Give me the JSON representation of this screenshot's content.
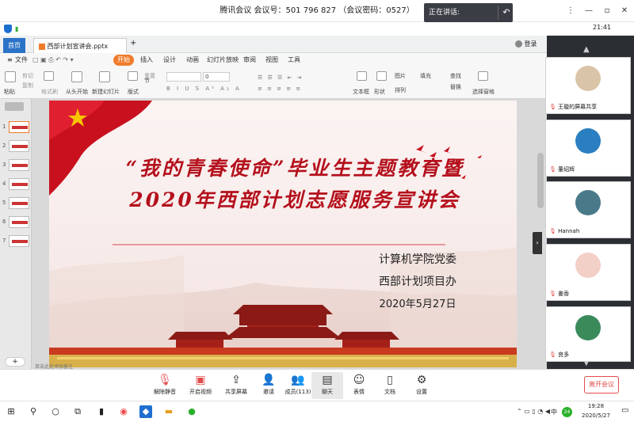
{
  "titlebar": {
    "meeting_title": "腾讯会议  会议号：501 796 827   （会议密码：0527）",
    "speaking_label": "正在讲话:",
    "time": "21:41"
  },
  "ppt": {
    "tabs": [
      {
        "label": "首页"
      },
      {
        "label": "西部计划宣讲会.pptx"
      }
    ],
    "tab_add": "+",
    "login_label": "登录",
    "file_menu": "文件",
    "menus": [
      "开始",
      "插入",
      "设计",
      "动画",
      "幻灯片放映",
      "审阅",
      "视图",
      "工具"
    ],
    "ribbon": {
      "paste": "粘贴",
      "cut": "剪切",
      "copy": "复制",
      "format_painter": "格式刷",
      "from_start": "从头开始",
      "new_slide": "新建幻灯片",
      "layout": "版式",
      "section": "节",
      "reset": "重置",
      "font_size": "0",
      "text_box": "文本框",
      "shape": "形状",
      "arrange": "排列",
      "picture": "图片",
      "fill": "填充",
      "find": "查找",
      "replace": "替换",
      "select_pane": "选择窗格"
    },
    "slide_numbers": [
      "1",
      "2",
      "3",
      "4",
      "5",
      "6",
      "7"
    ],
    "notes_hint": "单击此处添加备注",
    "slide": {
      "title_line1": "“我的青春使命”毕业生主题教育暨",
      "title_line2": "2020年西部计划志愿服务宣讲会",
      "org1": "计算机学院党委",
      "org2": "西部计划项目办",
      "date": "2020年5月27日"
    }
  },
  "participants": [
    {
      "name": "王璇的屏幕共享",
      "avatar_color": "#d9c4a8"
    },
    {
      "name": "董绍辉",
      "avatar_color": "#2a7fc0"
    },
    {
      "name": "Hannah",
      "avatar_color": "#4a7a8a"
    },
    {
      "name": "姜香",
      "avatar_color": "#f2d0c8"
    },
    {
      "name": "良多",
      "avatar_color": "#3a8a5a"
    }
  ],
  "toolbar": {
    "mute": "解除静音",
    "video": "开启视频",
    "share": "共享屏幕",
    "invite": "邀请",
    "members": "成员(113)",
    "chat": "聊天",
    "reaction": "表情",
    "docs": "文档",
    "settings": "设置",
    "leave": "离开会议"
  },
  "taskbar": {
    "time": "19:28",
    "date": "2020/5/27",
    "lang": "中",
    "badge": "24"
  },
  "colors": {
    "accent_red": "#b4101c",
    "ppt_orange": "#f07c2b",
    "leave_red": "#e24b4b"
  }
}
